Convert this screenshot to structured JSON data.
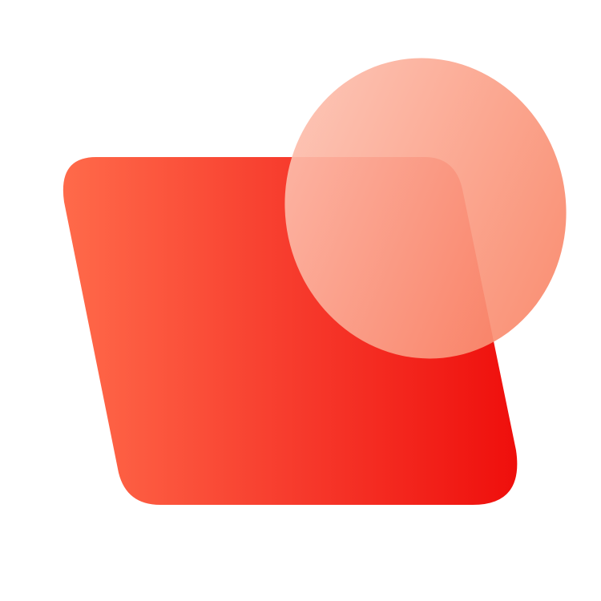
{
  "logo": {
    "icon": "red-parallelogram-with-translucent-circle-icon",
    "colors": {
      "background": "#ffffff",
      "parallelogram_light": "#ff6a4a",
      "parallelogram_mid": "#f6372a",
      "parallelogram_dark": "#ef0f0c",
      "circle_light": "#fdc3b3",
      "circle_dark": "#f98364"
    }
  }
}
